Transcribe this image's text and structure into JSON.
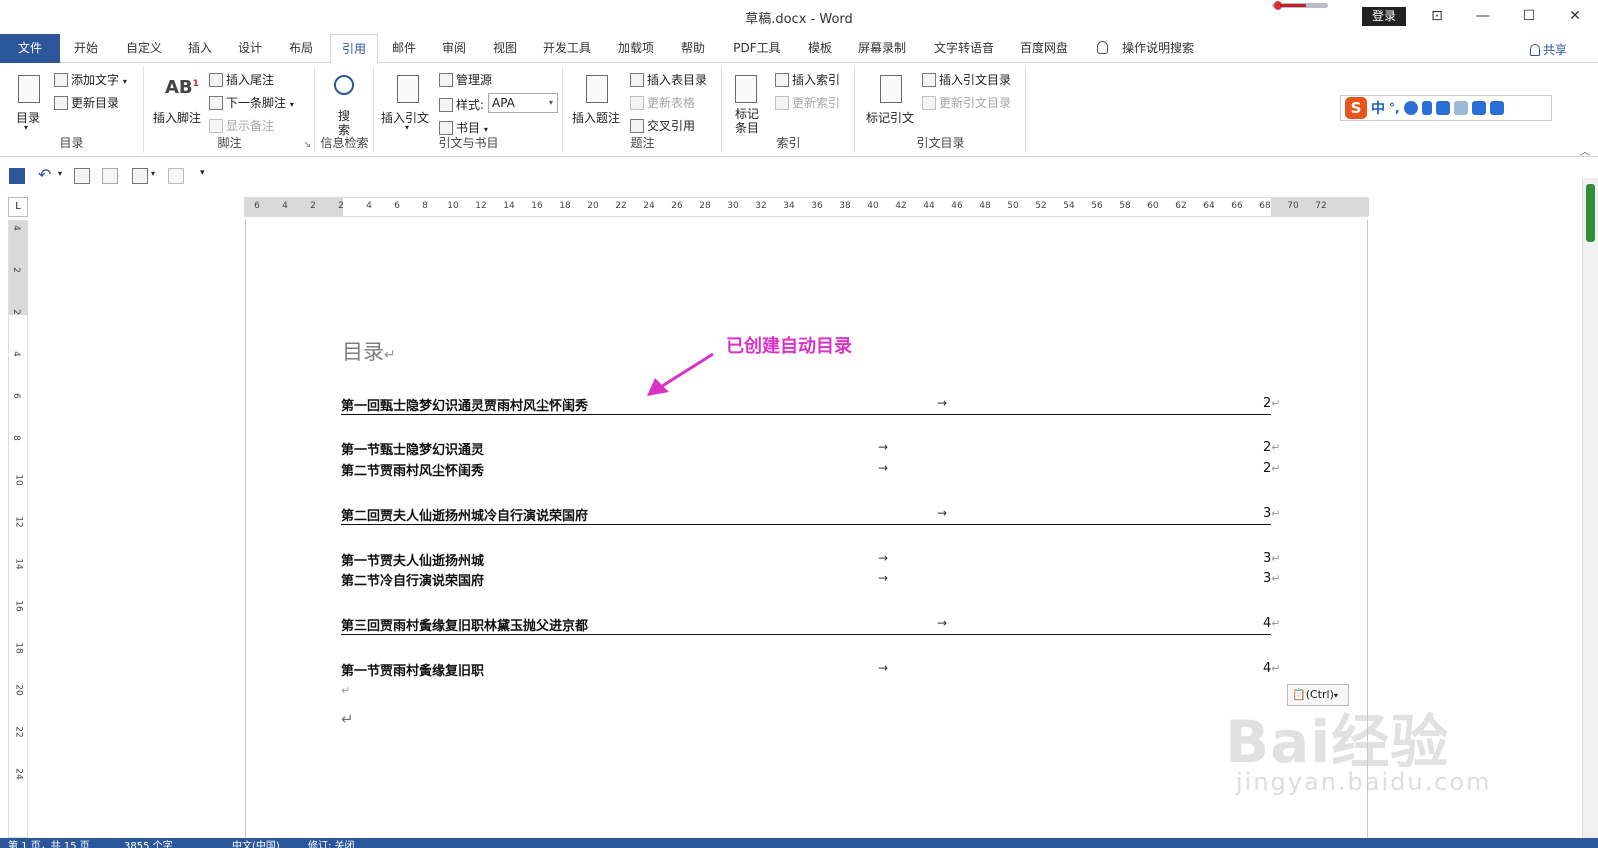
{
  "window": {
    "title": "草稿.docx - Word",
    "login_label": "登录"
  },
  "tabs": {
    "file": "文件",
    "items": [
      "开始",
      "自定义",
      "插入",
      "设计",
      "布局",
      "引用",
      "邮件",
      "审阅",
      "视图",
      "开发工具",
      "加载项",
      "帮助",
      "PDF工具",
      "模板",
      "屏幕录制",
      "文字转语音",
      "百度网盘"
    ],
    "active": "引用",
    "search_label": "操作说明搜索",
    "share_label": "共享"
  },
  "ribbon": {
    "toc_group": {
      "label": "目录",
      "toc_button": "目录",
      "add_text": "添加文字",
      "update_toc": "更新目录"
    },
    "footnote_group": {
      "label": "脚注",
      "insert_footnote": "插入脚注",
      "insert_endnote": "插入尾注",
      "next_footnote": "下一条脚注",
      "show_notes": "显示备注"
    },
    "research_group": {
      "label": "信息检索",
      "search_button": "搜\n索"
    },
    "citation_group": {
      "label": "引文与书目",
      "insert_citation": "插入引文",
      "manage_sources": "管理源",
      "style_label": "样式:",
      "style_value": "APA",
      "bibliography": "书目"
    },
    "caption_group": {
      "label": "题注",
      "insert_caption": "插入题注",
      "insert_table_of_figures": "插入表目录",
      "update_table": "更新表格",
      "cross_reference": "交叉引用"
    },
    "index_group": {
      "label": "索引",
      "mark_entry": "标记\n条目",
      "insert_index": "插入索引",
      "update_index": "更新索引"
    },
    "authorities_group": {
      "label": "引文目录",
      "mark_citation": "标记引文",
      "insert_toa": "插入引文目录",
      "update_toa": "更新引文目录"
    }
  },
  "ime": {
    "zh": "中"
  },
  "ruler": {
    "h_numbers": [
      "6",
      "4",
      "2",
      "2",
      "4",
      "6",
      "8",
      "10",
      "12",
      "14",
      "16",
      "18",
      "20",
      "22",
      "24",
      "26",
      "28",
      "30",
      "32",
      "34",
      "36",
      "38",
      "40",
      "42",
      "44",
      "46",
      "48",
      "50",
      "52",
      "54",
      "56",
      "58",
      "60",
      "62",
      "64",
      "66",
      "68",
      "70",
      "72"
    ],
    "v_numbers": [
      "4",
      "2",
      "2",
      "4",
      "6",
      "8",
      "10",
      "12",
      "14",
      "16",
      "18",
      "20",
      "22",
      "24"
    ],
    "corner": "L"
  },
  "document": {
    "title": "目录",
    "toc": [
      {
        "text": "第一回甄士隐梦幻识通灵贾雨村风尘怀闺秀",
        "page": "2",
        "level": 1
      },
      {
        "text": "第一节甄士隐梦幻识通灵",
        "page": "2",
        "level": 2
      },
      {
        "text": "第二节贾雨村风尘怀闺秀",
        "page": "2",
        "level": 2
      },
      {
        "text": "第二回贾夫人仙逝扬州城冷自行演说荣国府",
        "page": "3",
        "level": 1
      },
      {
        "text": "第一节贾夫人仙逝扬州城",
        "page": "3",
        "level": 2
      },
      {
        "text": "第二节冷自行演说荣国府",
        "page": "3",
        "level": 2
      },
      {
        "text": "第三回贾雨村夤缘复旧职林黛玉抛父进京都",
        "page": "4",
        "level": 1
      },
      {
        "text": "第一节贾雨村夤缘复旧职",
        "page": "4",
        "level": 2
      }
    ],
    "tab_arrow": "→",
    "return_mark": "↵"
  },
  "annotation": {
    "text": "已创建自动目录",
    "color": "#d932c8"
  },
  "paste_options": {
    "label": "(Ctrl)"
  },
  "watermark": {
    "brand": "Bai经验",
    "url": "jingyan.baidu.com"
  },
  "statusbar": {
    "page": "第 1 页，共 15 页",
    "words": "3855 个字",
    "language": "中文(中国)",
    "track": "修订: 关闭"
  },
  "colors": {
    "accent": "#2b579a"
  }
}
